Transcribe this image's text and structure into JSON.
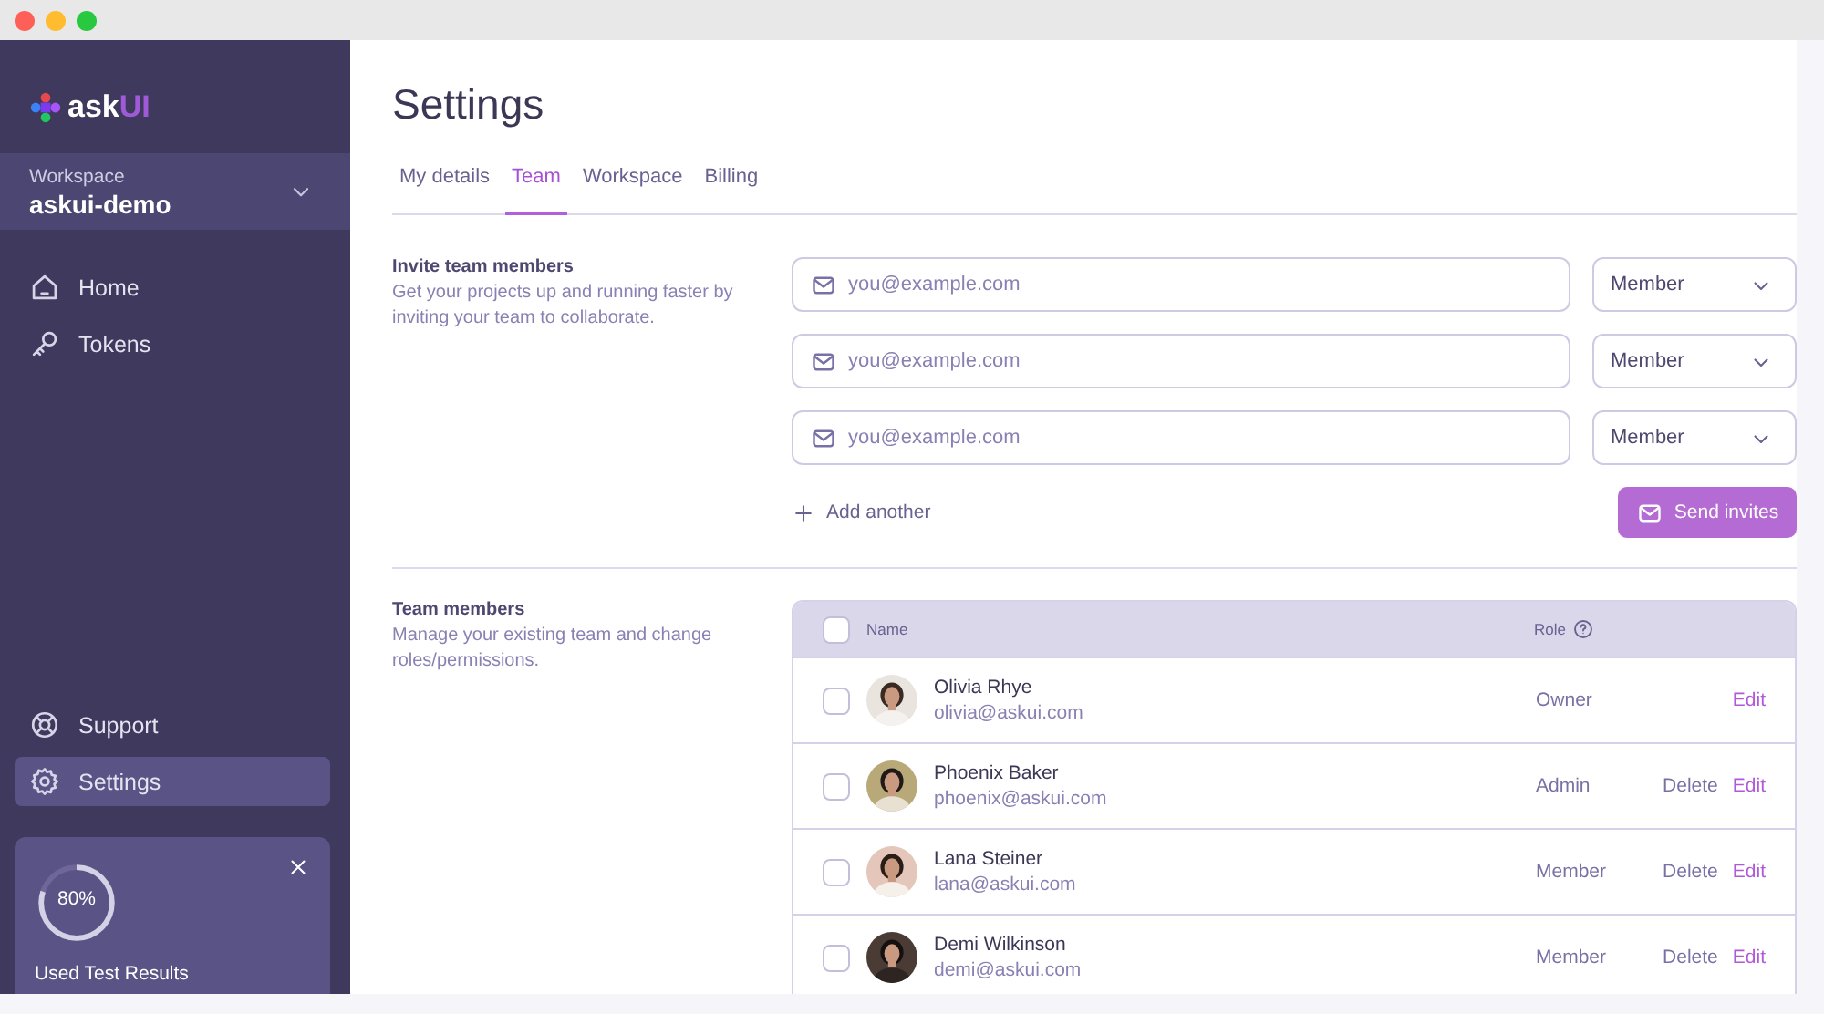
{
  "sidebar": {
    "logo": {
      "text": "ask",
      "accent": "UI"
    },
    "workspace": {
      "label": "Workspace",
      "name": "askui-demo"
    },
    "nav_items": [
      {
        "label": "Home",
        "selected": false
      },
      {
        "label": "Tokens",
        "selected": false
      }
    ],
    "bottom_items": [
      {
        "label": "Support",
        "selected": false
      },
      {
        "label": "Settings",
        "selected": true
      }
    ],
    "usage_card": {
      "level": 0.8,
      "percent": "80%",
      "label": "Used Test Results"
    }
  },
  "page": {
    "title": "Settings",
    "tabs": [
      {
        "label": "My details",
        "selected": false
      },
      {
        "label": "Team",
        "selected": true
      },
      {
        "label": "Workspace",
        "selected": false
      },
      {
        "label": "Billing",
        "selected": false
      }
    ],
    "invite": {
      "heading": "Invite team members",
      "description": "Get your projects up and running faster by inviting your team to collaborate.",
      "rows": [
        {
          "placeholder": "you@example.com",
          "role": "Member"
        },
        {
          "placeholder": "you@example.com",
          "role": "Member"
        },
        {
          "placeholder": "you@example.com",
          "role": "Member"
        }
      ],
      "add_label": "Add another",
      "send_label": "Send invites"
    },
    "team": {
      "heading": "Team members",
      "description": "Manage your existing team and change roles/permissions.",
      "table": {
        "columns": [
          "Name",
          "Role"
        ],
        "all_checked": false,
        "rows": [
          {
            "name": "Olivia Rhye",
            "email": "olivia@askui.com",
            "role": "Owner",
            "checked": false,
            "avatar": {
              "kind": "picture"
            },
            "actions": [
              {
                "label": "Edit",
                "kind": "edit"
              }
            ]
          },
          {
            "name": "Phoenix Baker",
            "email": "phoenix@askui.com",
            "role": "Admin",
            "checked": false,
            "avatar": {
              "kind": "picture"
            },
            "actions": [
              {
                "label": "Delete",
                "kind": "delete"
              },
              {
                "label": "Edit",
                "kind": "edit"
              }
            ]
          },
          {
            "name": "Lana Steiner",
            "email": "lana@askui.com",
            "role": "Member",
            "checked": false,
            "avatar": {
              "kind": "picture"
            },
            "actions": [
              {
                "label": "Delete",
                "kind": "delete"
              },
              {
                "label": "Edit",
                "kind": "edit"
              }
            ]
          },
          {
            "name": "Demi Wilkinson",
            "email": "demi@askui.com",
            "role": "Member",
            "checked": false,
            "avatar": {
              "kind": "picture"
            },
            "actions": [
              {
                "label": "Delete",
                "kind": "delete"
              },
              {
                "label": "Edit",
                "kind": "edit"
              }
            ]
          }
        ]
      }
    }
  }
}
